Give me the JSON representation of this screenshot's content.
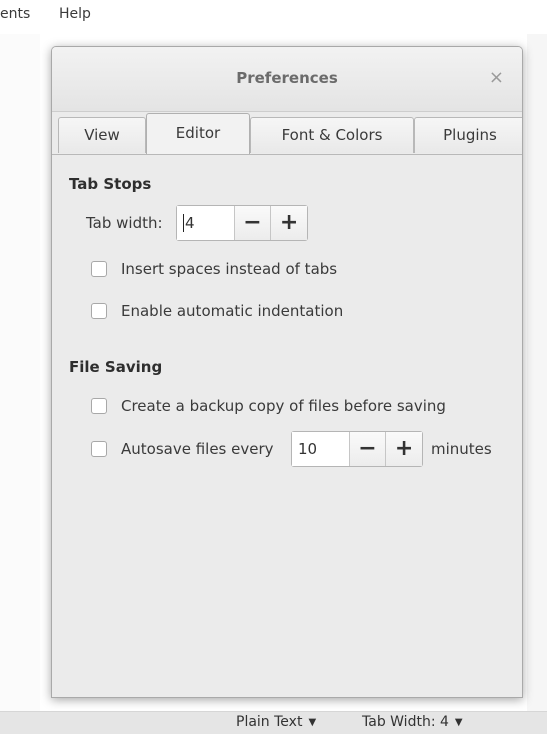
{
  "menubar": {
    "items": [
      "ents",
      "Help"
    ]
  },
  "dialog": {
    "title": "Preferences",
    "close_glyph": "×",
    "tabs": [
      {
        "label": "View",
        "active": false
      },
      {
        "label": "Editor",
        "active": true
      },
      {
        "label": "Font & Colors",
        "active": false
      },
      {
        "label": "Plugins",
        "active": false
      }
    ],
    "tab_stops": {
      "heading": "Tab Stops",
      "tab_width_label": "Tab width:",
      "tab_width_value": "4",
      "insert_spaces": {
        "label": "Insert spaces instead of tabs",
        "checked": false
      },
      "auto_indent": {
        "label": "Enable automatic indentation",
        "checked": false
      }
    },
    "file_saving": {
      "heading": "File Saving",
      "backup": {
        "label": "Create a backup copy of files before saving",
        "checked": false
      },
      "autosave": {
        "label": "Autosave files every",
        "checked": false,
        "value": "10",
        "unit": "minutes"
      }
    },
    "minus_glyph": "−",
    "plus_glyph": "+"
  },
  "statusbar": {
    "language": "Plain Text",
    "tab_width": "Tab Width: 4",
    "arrow_glyph": "▼"
  }
}
